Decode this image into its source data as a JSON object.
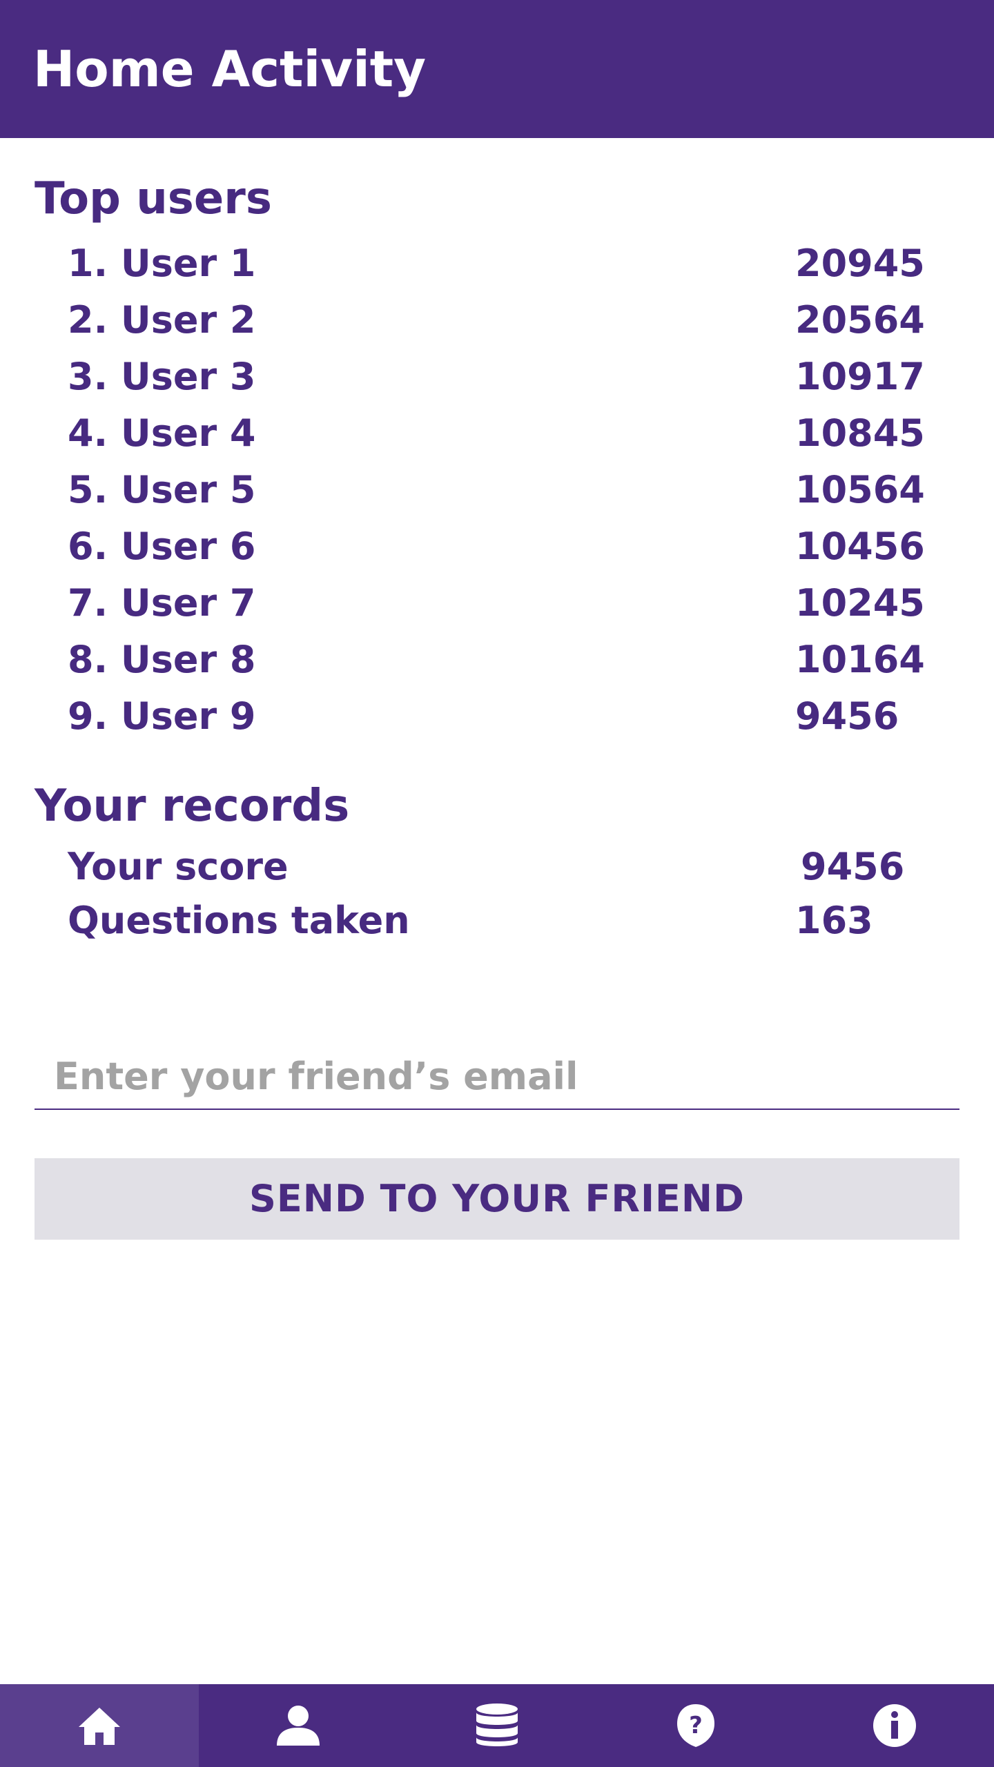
{
  "app_bar": {
    "title": "Home Activity",
    "background": "#4a2b81"
  },
  "top_users": {
    "heading": "Top users",
    "rows": [
      {
        "label": "1. User 1",
        "score": "20945"
      },
      {
        "label": "2. User 2",
        "score": "20564"
      },
      {
        "label": "3. User 3",
        "score": "10917"
      },
      {
        "label": "4. User 4",
        "score": "10845"
      },
      {
        "label": "5. User 5",
        "score": "10564"
      },
      {
        "label": "6. User 6",
        "score": "10456"
      },
      {
        "label": "7. User 7",
        "score": "10245"
      },
      {
        "label": "8. User 8",
        "score": "10164"
      },
      {
        "label": "9. User 9",
        "score": "9456"
      }
    ]
  },
  "records": {
    "heading": "Your records",
    "score_label": "Your score",
    "score_value": "9456",
    "questions_label": "Questions taken",
    "questions_value": "163"
  },
  "invite": {
    "email_value": "",
    "email_placeholder": "Enter your friend’s email",
    "send_label": "SEND TO YOUR FRIEND"
  },
  "bottom_nav": {
    "active": "home",
    "items": [
      {
        "id": "home",
        "icon": "home-icon"
      },
      {
        "id": "profile",
        "icon": "user-icon"
      },
      {
        "id": "database",
        "icon": "database-icon"
      },
      {
        "id": "questions",
        "icon": "question-icon"
      },
      {
        "id": "info",
        "icon": "info-icon"
      }
    ]
  },
  "colors": {
    "primary": "#4a2b81",
    "text": "#472a80",
    "nav_active": "#5a3f8e",
    "button_bg": "#e1e0e6",
    "placeholder": "#a3a3a3"
  }
}
